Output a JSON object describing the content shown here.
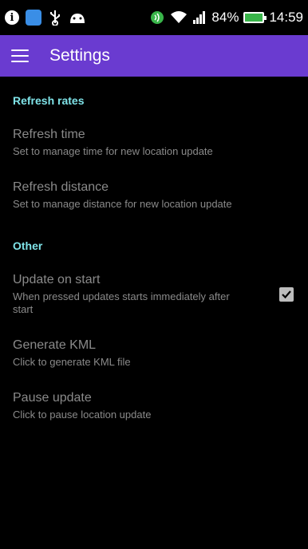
{
  "status_bar": {
    "battery": "84%",
    "time": "14:59",
    "icons": [
      "info-icon",
      "app-icon",
      "usb-icon",
      "android-icon",
      "nfc-icon",
      "wifi-icon",
      "signal-icon",
      "battery-icon"
    ]
  },
  "app_bar": {
    "title": "Settings",
    "menu_icon": "hamburger-menu-icon"
  },
  "sections": {
    "refresh": {
      "header": "Refresh rates",
      "items": [
        {
          "title": "Refresh time",
          "summary": "Set to manage time for new location update"
        },
        {
          "title": "Refresh distance",
          "summary": "Set to manage distance for new location update"
        }
      ]
    },
    "other": {
      "header": "Other",
      "items": [
        {
          "title": "Update on start",
          "summary": "When pressed updates starts immediately after start",
          "checked": true
        },
        {
          "title": "Generate KML",
          "summary": "Click to generate KML file"
        },
        {
          "title": "Pause update",
          "summary": "Click to pause location update"
        }
      ]
    }
  },
  "colors": {
    "app_bar": "#6a3bd0",
    "section_header": "#7fe3e8",
    "background": "#000000",
    "text_disabled": "#8a8a8a"
  }
}
